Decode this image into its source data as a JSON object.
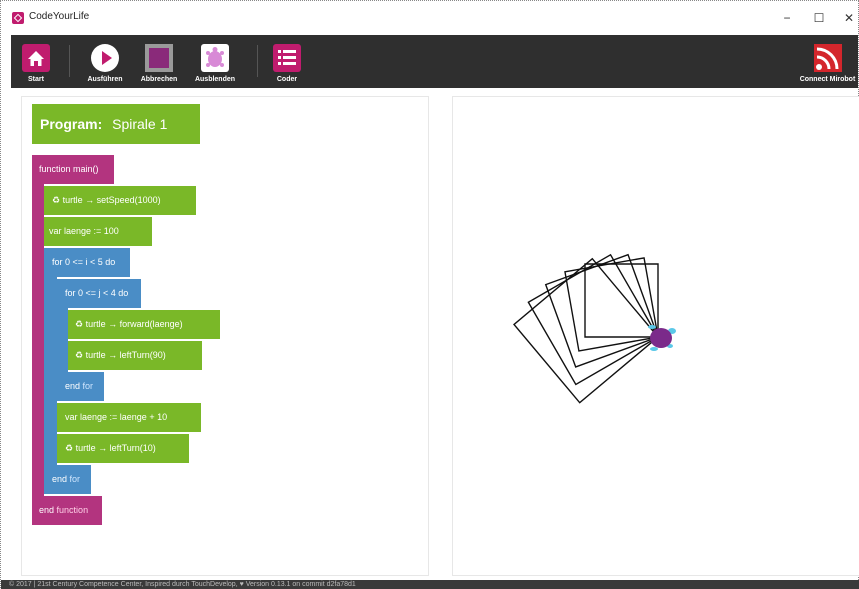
{
  "window": {
    "title": "CodeYourLife",
    "controls": [
      "−",
      "☐",
      "✕"
    ]
  },
  "toolbar": {
    "items": [
      {
        "label": "Start",
        "icon": "home-icon"
      },
      {
        "label": "Ausführen",
        "icon": "play-icon"
      },
      {
        "label": "Abbrechen",
        "icon": "stop-icon"
      },
      {
        "label": "Ausblenden",
        "icon": "turtle-icon"
      },
      {
        "label": "Coder",
        "icon": "list-icon"
      }
    ],
    "connect_label": "Connect Mirobot",
    "colors": {
      "bg": "#2f2f2f",
      "accent": "#c01c6e"
    }
  },
  "program": {
    "title_label": "Program:",
    "title_name": "Spirale 1",
    "lines": {
      "main": "function main()",
      "speed": "♻ turtle → setSpeed(1000)",
      "var1": "var laenge := 100",
      "for_i": "for 0 <= i < 5 do",
      "for_j": "for 0 <= j < 4 do",
      "forward": "♻ turtle → forward(laenge)",
      "left90": "♻ turtle → leftTurn(90)",
      "endfor_inner_a": "end",
      "endfor_inner_b": "for",
      "var2": "var laenge := laenge + 10",
      "left10": "♻ turtle → leftTurn(10)",
      "endfor_outer_a": "end",
      "endfor_outer_b": "for",
      "endfunc_a": "end",
      "endfunc_b": "function"
    }
  },
  "canvas": {
    "turtle_color": "#7b2a8a",
    "line_color": "#111111"
  },
  "footer": {
    "text": "© 2017 | 21st Century Competence Center, Inspired durch TouchDevelop, ♥ Version 0.13.1 on commit d2fa78d1"
  }
}
